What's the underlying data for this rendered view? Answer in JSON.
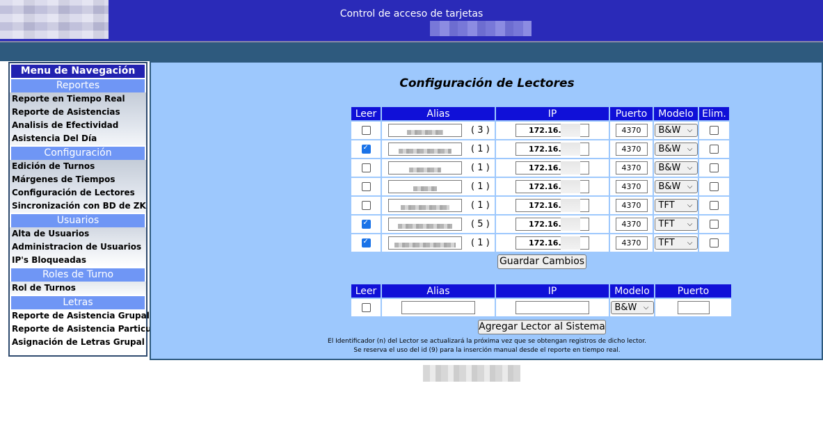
{
  "header": {
    "title": "Control de acceso de tarjetas"
  },
  "sidebar": {
    "title": "Menu de Navegación",
    "sections": [
      {
        "label": "Reportes",
        "items": [
          "Reporte en Tiempo Real",
          "Reporte de Asistencias",
          "Analisis de Efectividad",
          "Asistencia Del Día"
        ]
      },
      {
        "label": "Configuración",
        "items": [
          "Edición de Turnos",
          "Márgenes de Tiempos",
          "Configuración de Lectores",
          "Sincronización con BD de ZK"
        ]
      },
      {
        "label": "Usuarios",
        "items": [
          "Alta de Usuarios",
          "Administracion de Usuarios",
          "IP's Bloqueadas"
        ]
      },
      {
        "label": "Roles de Turno",
        "items": [
          "Rol de Turnos"
        ]
      },
      {
        "label": "Letras",
        "items": [
          "Reporte de Asistencia Grupal",
          "Reporte de Asistencia Particular",
          "Asignación de Letras Grupal"
        ]
      }
    ]
  },
  "main": {
    "title": "Configuración de Lectores",
    "readers_table": {
      "headers": [
        "Leer",
        "Alias",
        "IP",
        "Puerto",
        "Modelo",
        "Elim."
      ],
      "rows": [
        {
          "leer": false,
          "id": "( 3 )",
          "ip": "172.16.0",
          "puerto": "4370",
          "modelo": "B&W",
          "elim": false
        },
        {
          "leer": true,
          "id": "( 1 )",
          "ip": "172.16.0",
          "puerto": "4370",
          "modelo": "B&W",
          "elim": false
        },
        {
          "leer": false,
          "id": "( 1 )",
          "ip": "172.16.0",
          "puerto": "4370",
          "modelo": "B&W",
          "elim": false
        },
        {
          "leer": false,
          "id": "( 1 )",
          "ip": "172.16.0",
          "puerto": "4370",
          "modelo": "B&W",
          "elim": false
        },
        {
          "leer": false,
          "id": "( 1 )",
          "ip": "172.16.0",
          "puerto": "4370",
          "modelo": "TFT",
          "elim": false
        },
        {
          "leer": true,
          "id": "( 5 )",
          "ip": "172.16.0",
          "puerto": "4370",
          "modelo": "TFT",
          "elim": false
        },
        {
          "leer": true,
          "id": "( 1 )",
          "ip": "172.16.0",
          "puerto": "4370",
          "modelo": "TFT",
          "elim": false
        }
      ]
    },
    "save_button": "Guardar Cambios",
    "add_table": {
      "headers": [
        "Leer",
        "Alias",
        "IP",
        "Modelo",
        "Puerto"
      ],
      "leer": false,
      "alias": "",
      "ip": "",
      "modelo": "B&W",
      "puerto": ""
    },
    "add_button": "Agregar Lector al Sistema",
    "notes": [
      "El Identificador (n) del Lector se actualizará la próxima vez que se obtengan registros de dicho lector.",
      "Se reserva el uso del id (9) para la inserción manual desde el reporte en tiempo real."
    ]
  }
}
